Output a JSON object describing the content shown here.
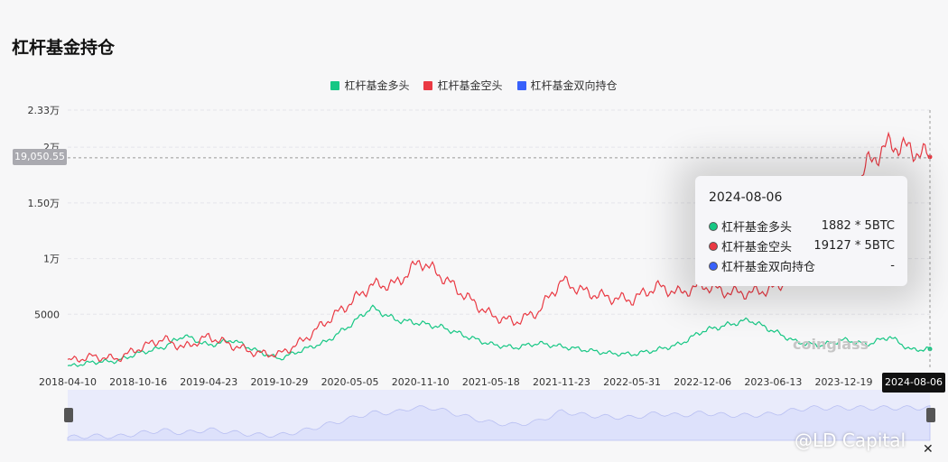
{
  "page": {
    "title": "杠杆基金持仓",
    "crosshair_value": "19,050.55",
    "watermark": "coinglass",
    "corner_watermark": "@LD Capital",
    "close_glyph": "✕"
  },
  "tooltip": {
    "date": "2024-08-06",
    "rows": [
      {
        "name": "杠杆基金多头",
        "value": "1882 * 5BTC",
        "color": "#16c784"
      },
      {
        "name": "杠杆基金空头",
        "value": "19127 * 5BTC",
        "color": "#ea3943"
      },
      {
        "name": "杠杆基金双向持仓",
        "value": "-",
        "color": "#3861fb"
      }
    ]
  },
  "chart_data": {
    "type": "line",
    "title": "杠杆基金持仓",
    "ylim": [
      0,
      23333
    ],
    "y_ticks": [
      {
        "value": 5000,
        "label": "5000"
      },
      {
        "value": 10000,
        "label": "1万"
      },
      {
        "value": 15000,
        "label": "1.50万"
      },
      {
        "value": 20000,
        "label": "2万"
      },
      {
        "value": 23333,
        "label": "2.33万"
      }
    ],
    "x_ticks": [
      "2018-04-10",
      "2018-10-16",
      "2019-04-23",
      "2019-10-29",
      "2020-05-05",
      "2020-11-10",
      "2021-05-18",
      "2021-11-23",
      "2022-05-31",
      "2022-12-06",
      "2023-06-13",
      "2023-12-19"
    ],
    "x_range": [
      "2018-04-10",
      "2024-08-06"
    ],
    "highlight_date": "2024-08-06",
    "grid": true,
    "legend_position": "top-center",
    "colors": {
      "long": "#16c784",
      "short": "#ea3943",
      "both": "#3861fb",
      "navigator_fill": "#dde1fb"
    },
    "series": [
      {
        "name": "杠杆基金多头",
        "key": "long",
        "x": [
          "2018-04-10",
          "2018-06-15",
          "2018-08-20",
          "2018-10-16",
          "2018-12-20",
          "2019-02-15",
          "2019-04-23",
          "2019-06-25",
          "2019-08-30",
          "2019-10-29",
          "2019-12-30",
          "2020-03-01",
          "2020-05-05",
          "2020-07-01",
          "2020-09-05",
          "2020-11-10",
          "2021-01-10",
          "2021-03-15",
          "2021-05-18",
          "2021-07-20",
          "2021-09-20",
          "2021-11-23",
          "2022-01-25",
          "2022-03-30",
          "2022-05-31",
          "2022-08-05",
          "2022-10-05",
          "2022-12-06",
          "2023-02-06",
          "2023-04-10",
          "2023-06-13",
          "2023-08-15",
          "2023-10-17",
          "2023-12-19",
          "2024-02-20",
          "2024-04-20",
          "2024-06-15",
          "2024-08-06"
        ],
        "values": [
          300,
          700,
          800,
          1500,
          2000,
          3100,
          2200,
          2700,
          1700,
          1000,
          1800,
          2500,
          4000,
          5600,
          4500,
          4200,
          3800,
          3000,
          2300,
          2000,
          2400,
          2100,
          1800,
          1500,
          1400,
          1800,
          2300,
          3500,
          4000,
          4500,
          3500,
          2500,
          2200,
          2700,
          2300,
          3000,
          1800,
          1882
        ]
      },
      {
        "name": "杠杆基金空头",
        "key": "short",
        "x": [
          "2018-04-10",
          "2018-06-15",
          "2018-08-20",
          "2018-10-16",
          "2018-12-20",
          "2019-02-15",
          "2019-04-23",
          "2019-06-25",
          "2019-08-30",
          "2019-10-29",
          "2019-12-30",
          "2020-03-01",
          "2020-05-05",
          "2020-07-01",
          "2020-09-05",
          "2020-11-10",
          "2021-01-10",
          "2021-03-15",
          "2021-05-18",
          "2021-07-20",
          "2021-09-20",
          "2021-11-23",
          "2022-01-25",
          "2022-03-30",
          "2022-05-31",
          "2022-08-05",
          "2022-10-05",
          "2022-12-06",
          "2023-02-06",
          "2023-04-10",
          "2023-06-13",
          "2023-08-15",
          "2023-10-17",
          "2023-12-19",
          "2024-02-20",
          "2024-04-20",
          "2024-06-15",
          "2024-08-06"
        ],
        "values": [
          800,
          1200,
          1000,
          1900,
          2800,
          2000,
          3000,
          2200,
          1500,
          1400,
          2600,
          4300,
          6000,
          7600,
          7700,
          9800,
          8300,
          6500,
          4900,
          4300,
          5200,
          8000,
          7000,
          6500,
          6300,
          7500,
          6900,
          7600,
          7000,
          6900,
          7300,
          8500,
          9500,
          14000,
          18500,
          20300,
          19800,
          19127
        ]
      },
      {
        "name": "杠杆基金双向持仓",
        "key": "both",
        "x": [],
        "values": []
      }
    ]
  }
}
